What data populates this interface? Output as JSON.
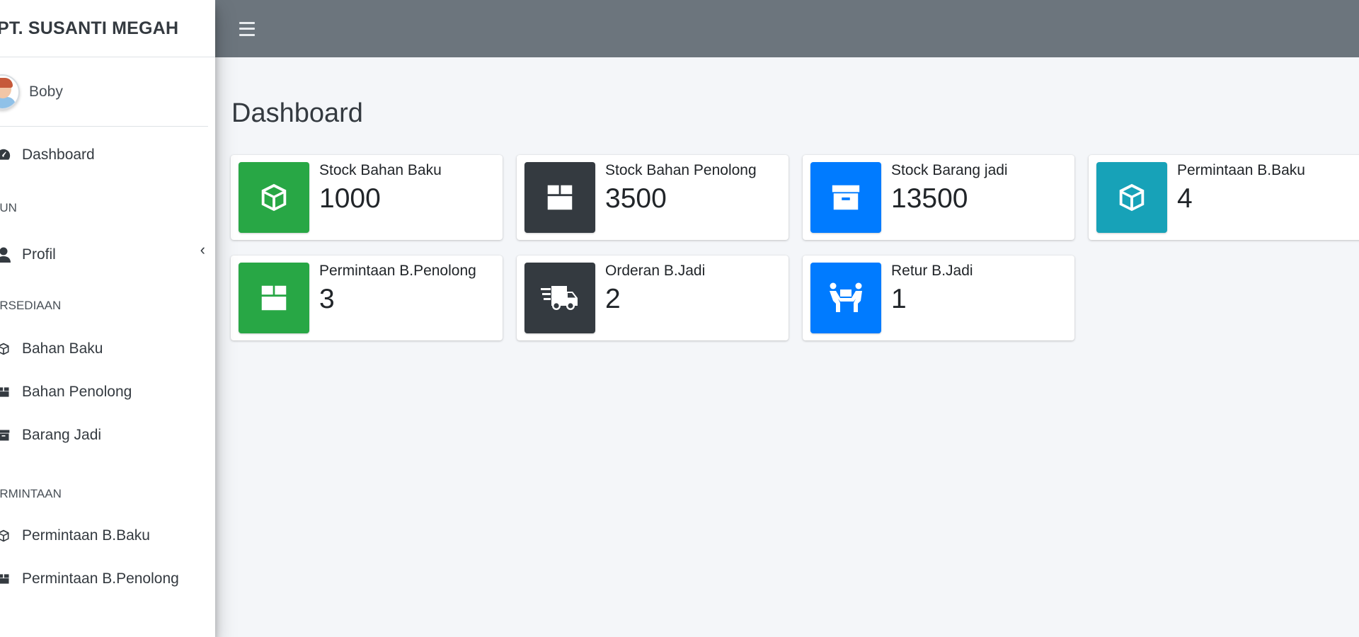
{
  "brand": {
    "title": "PT. SUSANTI MEGAH"
  },
  "user": {
    "name": "Boby"
  },
  "sidebar": {
    "dashboard": {
      "label": "Dashboard",
      "icon": "dashboard-gauge-icon"
    },
    "section_akun": "KUN",
    "profil": {
      "label": "Profil",
      "icon": "user-icon",
      "caret": "‹"
    },
    "section_persediaan": "ERSEDIAAN",
    "bahan_baku": {
      "label": "Bahan Baku",
      "icon": "cube-icon"
    },
    "bahan_penolong": {
      "label": "Bahan Penolong",
      "icon": "box-icon"
    },
    "barang_jadi": {
      "label": "Barang Jadi",
      "icon": "archive-icon"
    },
    "section_permintaan": "ERMINTAAN",
    "permintaan_baku": {
      "label": "Permintaan B.Baku",
      "icon": "cube-icon"
    },
    "permintaan_penolong": {
      "label": "Permintaan B.Penolong",
      "icon": "box-icon"
    }
  },
  "topbar": {
    "menu_icon": "hamburger-icon"
  },
  "main": {
    "title": "Dashboard",
    "cards": [
      {
        "label": "Stock Bahan Baku",
        "value": "1000",
        "color": "#28a745",
        "icon": "cube-icon"
      },
      {
        "label": "Stock Bahan Penolong",
        "value": "3500",
        "color": "#343a40",
        "icon": "box-icon"
      },
      {
        "label": "Stock Barang jadi",
        "value": "13500",
        "color": "#007bff",
        "icon": "archive-icon"
      },
      {
        "label": "Permintaan B.Baku",
        "value": "4",
        "color": "#17a2b8",
        "icon": "cube-icon"
      },
      {
        "label": "Permintaan B.Penolong",
        "value": "3",
        "color": "#28a745",
        "icon": "box-icon"
      },
      {
        "label": "Orderan B.Jadi",
        "value": "2",
        "color": "#343a40",
        "icon": "shipping-fast-icon"
      },
      {
        "label": "Retur B.Jadi",
        "value": "1",
        "color": "#007bff",
        "icon": "people-carry-icon"
      }
    ]
  }
}
